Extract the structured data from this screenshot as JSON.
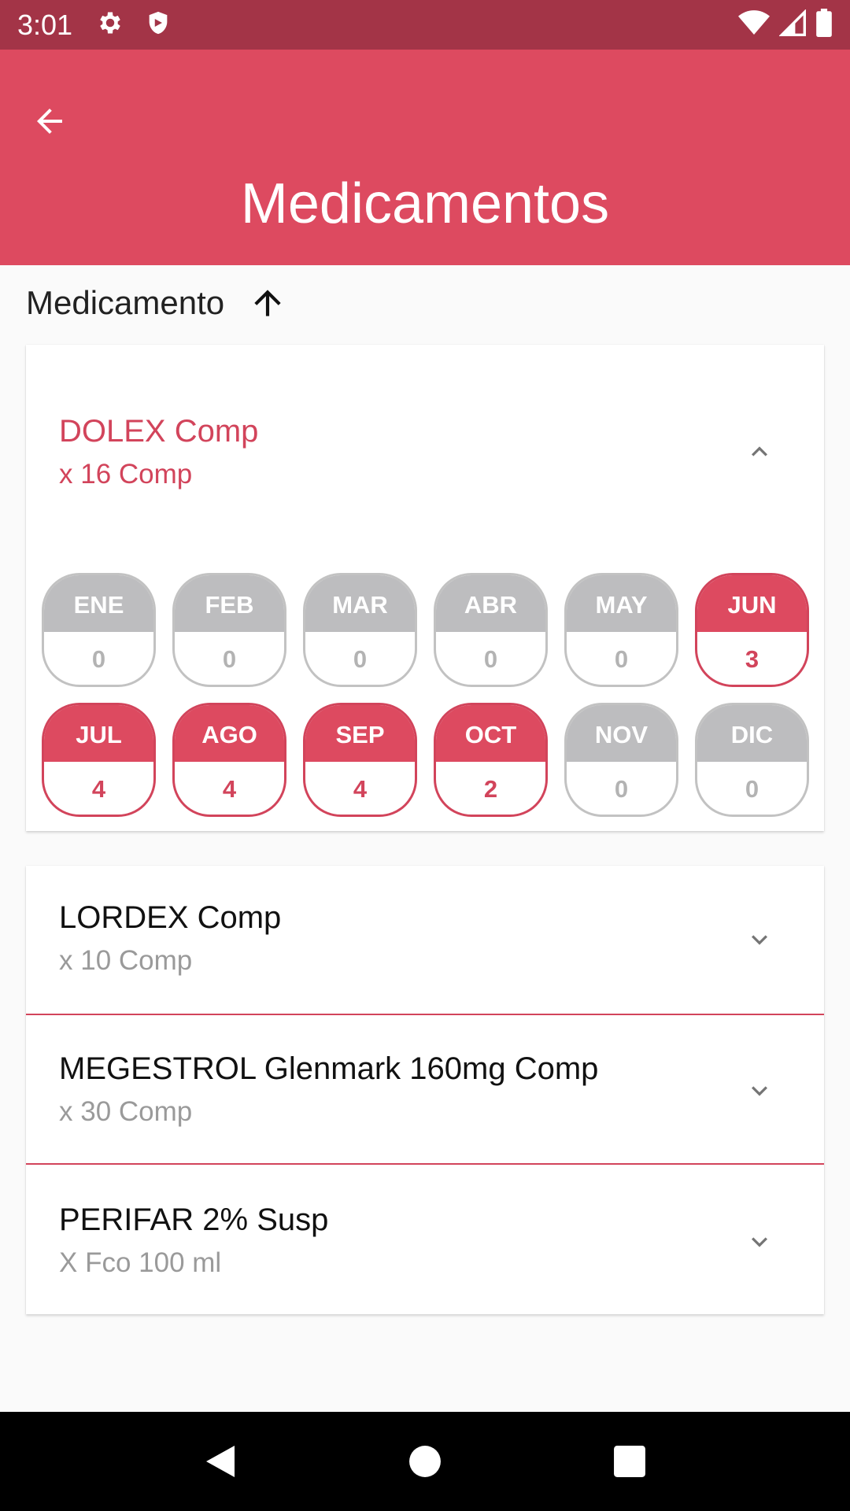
{
  "status_bar": {
    "time": "3:01",
    "icons_left": [
      "gear-icon",
      "shield-icon"
    ],
    "icons_right": [
      "wifi-icon",
      "signal-icon",
      "battery-icon"
    ]
  },
  "app_bar": {
    "title": "Medicamentos",
    "back_icon": "arrow-left-icon"
  },
  "sort": {
    "label": "Medicamento",
    "direction": "ascending",
    "icon": "arrow-up-icon"
  },
  "colors": {
    "primary": "#dd4a60",
    "status_bar": "#a33447",
    "accent_text": "#d2445b",
    "inactive_month": "#bdbdbf"
  },
  "expanded_medication": {
    "name": "DOLEX  Comp",
    "quantity": "x 16  Comp",
    "chevron_icon": "chevron-up-icon",
    "months": [
      {
        "label": "ENE",
        "value": "0",
        "active": false
      },
      {
        "label": "FEB",
        "value": "0",
        "active": false
      },
      {
        "label": "MAR",
        "value": "0",
        "active": false
      },
      {
        "label": "ABR",
        "value": "0",
        "active": false
      },
      {
        "label": "MAY",
        "value": "0",
        "active": false
      },
      {
        "label": "JUN",
        "value": "3",
        "active": true
      },
      {
        "label": "JUL",
        "value": "4",
        "active": true
      },
      {
        "label": "AGO",
        "value": "4",
        "active": true
      },
      {
        "label": "SEP",
        "value": "4",
        "active": true
      },
      {
        "label": "OCT",
        "value": "2",
        "active": true
      },
      {
        "label": "NOV",
        "value": "0",
        "active": false
      },
      {
        "label": "DIC",
        "value": "0",
        "active": false
      }
    ]
  },
  "medications": [
    {
      "name": "LORDEX Comp",
      "quantity": "x 10 Comp",
      "chevron_icon": "chevron-down-icon"
    },
    {
      "name": "MEGESTROL  Glenmark 160mg Comp",
      "quantity": "x 30 Comp",
      "chevron_icon": "chevron-down-icon"
    },
    {
      "name": "PERIFAR 2% Susp",
      "quantity": "X Fco 100 ml",
      "chevron_icon": "chevron-down-icon"
    }
  ],
  "nav_bar": {
    "icons": [
      "nav-back-icon",
      "nav-home-icon",
      "nav-recents-icon"
    ]
  }
}
